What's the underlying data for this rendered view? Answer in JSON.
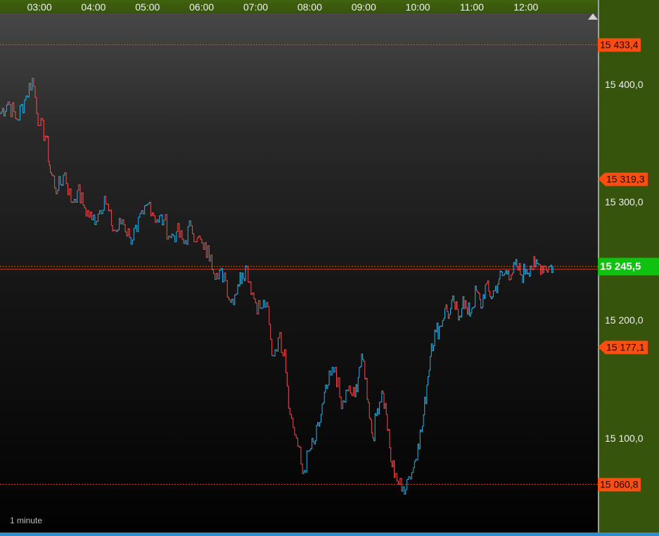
{
  "chart_data": {
    "type": "line",
    "instrument_interval": "1 minute",
    "time_labels": [
      "03:00",
      "04:00",
      "05:00",
      "06:00",
      "07:00",
      "08:00",
      "09:00",
      "10:00",
      "11:00",
      "12:00"
    ],
    "x_range_hours": [
      2.27,
      13.33
    ],
    "y_range": [
      15020,
      15460
    ],
    "price_ticks": [
      "15 400,0",
      "15 300,0",
      "15 200,0",
      "15 100,0"
    ],
    "price_tick_values": [
      15400,
      15300,
      15200,
      15100
    ],
    "levels": {
      "high": {
        "label": "15 433,4",
        "value": 15433.4
      },
      "upper_ref": {
        "label": "15 319,3",
        "value": 15319.3
      },
      "current": {
        "label": "15 245,5",
        "value": 15245.5
      },
      "lower_ref": {
        "label": "15 177,1",
        "value": 15177.1
      },
      "low": {
        "label": "15 060,8",
        "value": 15060.8
      }
    },
    "colors": {
      "up": "#2ab1e6",
      "down": "#ef4f4f",
      "level_tag": "#ff4e12",
      "current_tag": "#0fc20f",
      "axis_background": "#36540b"
    },
    "series": [
      {
        "x": [
          "02:16",
          "02:25",
          "02:35",
          "02:45",
          "02:52",
          "03:00",
          "03:08",
          "03:12",
          "03:20",
          "03:28",
          "03:35",
          "03:42",
          "03:50",
          "03:58",
          "04:05",
          "04:12",
          "04:20",
          "04:25",
          "04:32",
          "04:40",
          "04:48",
          "04:55",
          "05:02",
          "05:10",
          "05:18",
          "05:25",
          "05:32",
          "05:40",
          "05:48",
          "05:55",
          "06:02",
          "06:10",
          "06:18",
          "06:25",
          "06:32",
          "06:40",
          "06:45",
          "06:50",
          "06:58",
          "07:05",
          "07:12",
          "07:18",
          "07:25",
          "07:32",
          "07:38",
          "07:45",
          "07:52",
          "08:00",
          "08:05",
          "08:10",
          "08:15",
          "08:20",
          "08:28",
          "08:35",
          "08:42",
          "08:50",
          "08:55",
          "09:00",
          "09:05",
          "09:10",
          "09:15",
          "09:20",
          "09:25",
          "09:30",
          "09:35",
          "09:42",
          "09:48",
          "09:55",
          "10:00",
          "10:05",
          "10:10",
          "10:15",
          "10:20",
          "10:25",
          "10:30",
          "10:35",
          "10:40",
          "10:45",
          "10:50",
          "10:55",
          "11:00",
          "11:05",
          "11:10",
          "11:15",
          "11:20",
          "11:25",
          "11:30",
          "11:35",
          "11:40",
          "11:45",
          "11:50",
          "11:55",
          "12:00",
          "12:05",
          "12:10",
          "12:15",
          "12:20",
          "12:25",
          "12:30"
        ],
        "y": [
          15375,
          15385,
          15370,
          15390,
          15405,
          15365,
          15355,
          15325,
          15310,
          15325,
          15300,
          15310,
          15295,
          15285,
          15290,
          15305,
          15280,
          15275,
          15285,
          15270,
          15275,
          15290,
          15300,
          15285,
          15285,
          15270,
          15275,
          15265,
          15280,
          15270,
          15260,
          15255,
          15235,
          15240,
          15215,
          15230,
          15240,
          15245,
          15218,
          15210,
          15215,
          15170,
          15185,
          15175,
          15120,
          15100,
          15070,
          15090,
          15095,
          15110,
          15130,
          15145,
          15160,
          15125,
          15140,
          15135,
          15160,
          15165,
          15130,
          15100,
          15125,
          15140,
          15120,
          15080,
          15070,
          15055,
          15065,
          15075,
          15095,
          15110,
          15145,
          15180,
          15190,
          15195,
          15210,
          15205,
          15215,
          15200,
          15220,
          15205,
          15210,
          15225,
          15210,
          15230,
          15220,
          15225,
          15235,
          15238,
          15242,
          15240,
          15245,
          15238,
          15243,
          15246,
          15245,
          15247,
          15246,
          15245,
          15245.5
        ]
      }
    ]
  }
}
